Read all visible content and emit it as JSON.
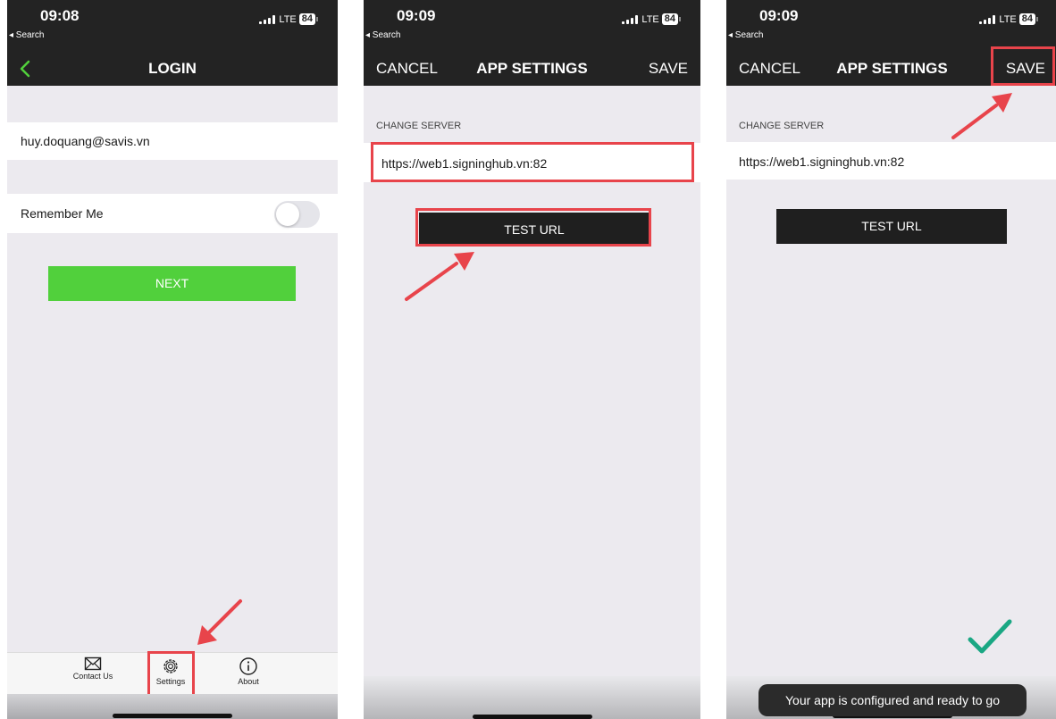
{
  "colors": {
    "bar": "#232323",
    "background": "#eceaef",
    "next_green": "#51d03c",
    "highlight_red": "#e8444b",
    "check_green": "#1aa783"
  },
  "screens": [
    {
      "status": {
        "time": "09:08",
        "back_label": "◂ Search",
        "network": "LTE",
        "battery": "84"
      },
      "nav": {
        "title": "LOGIN",
        "back_icon": "chevron-left-icon"
      },
      "email_value": "huy.doquang@savis.vn",
      "remember_label": "Remember Me",
      "remember_on": false,
      "next_label": "NEXT",
      "tabs": [
        {
          "label": "Contact Us",
          "icon": "envelope-icon"
        },
        {
          "label": "Settings",
          "icon": "gear-icon"
        },
        {
          "label": "About",
          "icon": "info-icon"
        }
      ]
    },
    {
      "status": {
        "time": "09:09",
        "back_label": "◂ Search",
        "network": "LTE",
        "battery": "84"
      },
      "nav": {
        "left": "CANCEL",
        "title": "APP SETTINGS",
        "right": "SAVE"
      },
      "section_label": "CHANGE SERVER",
      "server_url": "https://web1.signinghub.vn:82",
      "test_label": "TEST URL"
    },
    {
      "status": {
        "time": "09:09",
        "back_label": "◂ Search",
        "network": "LTE",
        "battery": "84"
      },
      "nav": {
        "left": "CANCEL",
        "title": "APP SETTINGS",
        "right": "SAVE"
      },
      "section_label": "CHANGE SERVER",
      "server_url": "https://web1.signinghub.vn:82",
      "test_label": "TEST URL",
      "toast": "Your app is configured and ready to go",
      "success_icon": "checkmark-icon"
    }
  ]
}
